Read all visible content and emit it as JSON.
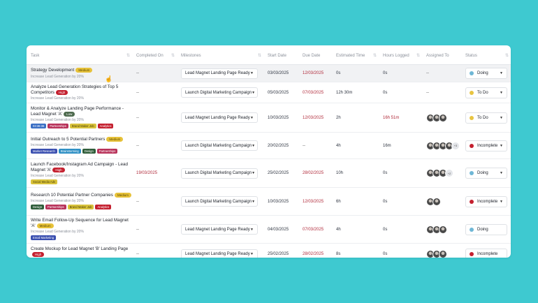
{
  "columns": [
    "Task",
    "Completed On",
    "Milestones",
    "Start Date",
    "Due Date",
    "Estimated Time",
    "Hours Logged",
    "Assigned To",
    "Status"
  ],
  "colors": {
    "background": "#3ec9d0",
    "status_doing": "#6fb7d6",
    "status_todo": "#e8c441",
    "status_incomplete": "#c4202f"
  },
  "rows": [
    {
      "task": "Strategy Development",
      "priority": "Medium",
      "priority_color": "#e7c23a",
      "goal": "Increase Lead Generation by 20%",
      "tags": [],
      "completed": "--",
      "milestone": "Lead Magnet Landing Page Ready",
      "start": "03/03/2025",
      "due": "12/03/2025",
      "est": "0s",
      "logged": "0s",
      "assigned_text": "--",
      "avatars": 0,
      "avatar_extra": "",
      "status": "Doing",
      "status_key": "doing",
      "status_caret": true,
      "height": 24,
      "highlight": true
    },
    {
      "task": "Analyze Lead Generation Strategies of Top 5 Competitors",
      "priority": "High",
      "priority_color": "#c4202f",
      "goal": "Increase Lead Generation by 20%",
      "tags": [],
      "completed": "--",
      "milestone": "Launch Digital Marketing Campaign",
      "start": "05/03/2025",
      "due": "07/03/2025",
      "est": "12h 30m",
      "logged": "0s",
      "assigned_text": "--",
      "avatars": 0,
      "avatar_extra": "",
      "status": "To Do",
      "status_key": "todo",
      "status_caret": true,
      "height": 29,
      "highlight": false
    },
    {
      "task": "Monitor & Analyze Landing Page Performance - Lead Magnet 'A'",
      "priority": "Low",
      "priority_color": "#4f6b4f",
      "goal": "Increase Lead Generation by 20%",
      "tags": [
        {
          "label": "03:36:36",
          "color": "#3a6fc4"
        },
        {
          "label": "Partnerships",
          "color": "#b8325a"
        },
        {
          "label": "Brand Maker Job",
          "color": "#d9c33c"
        },
        {
          "label": "Analytics",
          "color": "#c4202f"
        }
      ],
      "completed": "--",
      "milestone": "Lead Magnet Landing Page Ready",
      "start": "10/03/2025",
      "due": "12/03/2025",
      "est": "2h",
      "logged": "16h 51m",
      "assigned_text": "",
      "avatars": 3,
      "avatar_extra": "",
      "status": "To Do",
      "status_key": "todo",
      "status_caret": true,
      "height": 41,
      "highlight": false
    },
    {
      "task": "Initial Outreach to 5 Potential Partners",
      "priority": "Medium",
      "priority_color": "#e7c23a",
      "goal": "Increase Lead Generation by 20%",
      "tags": [
        {
          "label": "Market Research",
          "color": "#3a4fb0"
        },
        {
          "label": "Brainstorming",
          "color": "#2e8fc4"
        },
        {
          "label": "Design",
          "color": "#2f5d3a"
        },
        {
          "label": "Partnerships",
          "color": "#b8325a"
        }
      ],
      "completed": "--",
      "milestone": "Launch Digital Marketing Campaign",
      "start": "20/02/2025",
      "due": "--",
      "est": "4h",
      "logged": "16m",
      "assigned_text": "",
      "avatars": 4,
      "avatar_extra": "+3",
      "status": "Incomplete",
      "status_key": "incomplete",
      "status_caret": true,
      "height": 37,
      "highlight": false
    },
    {
      "task": "Launch Facebook/Instagram Ad Campaign - Lead Magnet 'A'",
      "priority": "High",
      "priority_color": "#c4202f",
      "goal": "Increase Lead Generation by 20%",
      "tags": [
        {
          "label": "Social Media Ads",
          "color": "#d9c33c"
        }
      ],
      "completed": "19/03/2025",
      "milestone": "Launch Digital Marketing Campaign",
      "start": "25/02/2025",
      "due": "28/02/2025",
      "est": "10h",
      "logged": "0s",
      "assigned_text": "",
      "avatars": 3,
      "avatar_extra": "+2",
      "status": "Doing",
      "status_key": "doing",
      "status_caret": true,
      "height": 40,
      "highlight": false
    },
    {
      "task": "Research 10 Potential Partner Companies",
      "priority": "Medium",
      "priority_color": "#e7c23a",
      "goal": "Increase Lead Generation by 20%",
      "tags": [
        {
          "label": "Design",
          "color": "#2f5d3a"
        },
        {
          "label": "Partnerships",
          "color": "#b8325a"
        },
        {
          "label": "Brand Maker Job",
          "color": "#d9c33c"
        },
        {
          "label": "Analytics",
          "color": "#c4202f"
        }
      ],
      "completed": "--",
      "milestone": "Launch Digital Marketing Campaign",
      "start": "10/03/2025",
      "due": "12/03/2025",
      "est": "6h",
      "logged": "0s",
      "assigned_text": "",
      "avatars": 2,
      "avatar_extra": "",
      "status": "Incomplete",
      "status_key": "incomplete",
      "status_caret": true,
      "height": 39,
      "highlight": false
    },
    {
      "task": "Write Email Follow-Up Sequence for Lead Magnet 'A'",
      "priority": "Medium",
      "priority_color": "#e7c23a",
      "goal": "Increase Lead Generation by 20%",
      "tags": [
        {
          "label": "Email Marketing",
          "color": "#3a4fb0"
        }
      ],
      "completed": "--",
      "milestone": "Lead Magnet Landing Page Ready",
      "start": "04/03/2025",
      "due": "07/03/2025",
      "est": "4h",
      "logged": "0s",
      "assigned_text": "",
      "avatars": 3,
      "avatar_extra": "",
      "status": "Doing",
      "status_key": "doing",
      "status_caret": false,
      "height": 39,
      "highlight": false
    },
    {
      "task": "Create Mockup for Lead Magnet 'B' Landing Page",
      "priority": "High",
      "priority_color": "#c4202f",
      "goal": "Increase Lead Generation by 20%",
      "tags": [],
      "completed": "--",
      "milestone": "Lead Magnet Landing Page Ready",
      "start": "25/02/2025",
      "due": "28/02/2025",
      "est": "8s",
      "logged": "0s",
      "assigned_text": "",
      "avatars": 3,
      "avatar_extra": "",
      "status": "Incomplete",
      "status_key": "incomplete",
      "status_caret": false,
      "height": 30,
      "highlight": false
    }
  ]
}
